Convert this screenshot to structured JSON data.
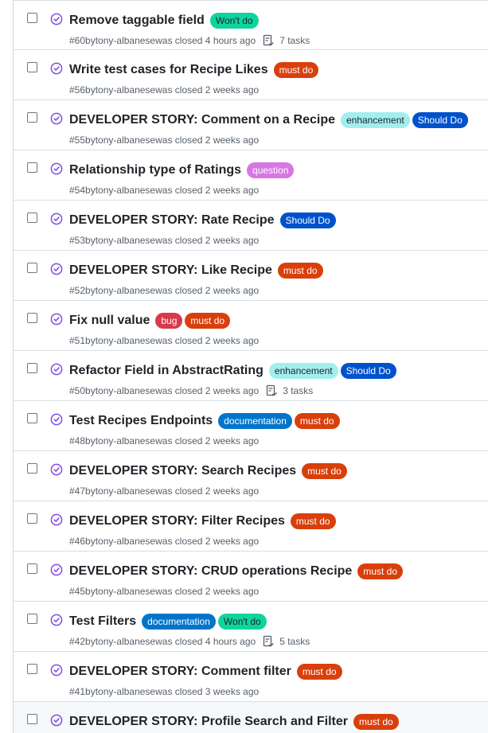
{
  "colors": {
    "closed_icon": "#8250df",
    "wont_do": "#0fd49e",
    "must_do": "#d93f0b",
    "enhancement": "#a2eeef",
    "should_do": "#0052cc",
    "question": "#d876e3",
    "bug": "#d73a4a",
    "documentation": "#0075ca"
  },
  "issues": [
    {
      "title": "Remove taggable field",
      "labels": [
        {
          "text": "Won't do",
          "kind": "wont_do"
        }
      ],
      "number": "#60",
      "by": "by",
      "author": "tony-albanese",
      "closed_text": "was closed 4 hours ago",
      "tasks": "7 tasks"
    },
    {
      "title": "Write test cases for Recipe Likes",
      "labels": [
        {
          "text": "must do",
          "kind": "must_do"
        }
      ],
      "number": "#56",
      "by": "by",
      "author": "tony-albanese",
      "closed_text": "was closed 2 weeks ago"
    },
    {
      "title": "DEVELOPER STORY: Comment on a Recipe",
      "labels": [
        {
          "text": "enhancement",
          "kind": "enhancement"
        },
        {
          "text": "Should Do",
          "kind": "should_do"
        }
      ],
      "number": "#55",
      "by": "by",
      "author": "tony-albanese",
      "closed_text": "was closed 2 weeks ago"
    },
    {
      "title": "Relationship type of Ratings",
      "labels": [
        {
          "text": "question",
          "kind": "question"
        }
      ],
      "number": "#54",
      "by": "by",
      "author": "tony-albanese",
      "closed_text": "was closed 2 weeks ago"
    },
    {
      "title": "DEVELOPER STORY: Rate Recipe",
      "labels": [
        {
          "text": "Should Do",
          "kind": "should_do"
        }
      ],
      "number": "#53",
      "by": "by",
      "author": "tony-albanese",
      "closed_text": "was closed 2 weeks ago"
    },
    {
      "title": "DEVELOPER STORY: Like Recipe",
      "labels": [
        {
          "text": "must do",
          "kind": "must_do"
        }
      ],
      "number": "#52",
      "by": "by",
      "author": "tony-albanese",
      "closed_text": "was closed 2 weeks ago"
    },
    {
      "title": "Fix null value",
      "labels": [
        {
          "text": "bug",
          "kind": "bug"
        },
        {
          "text": "must do",
          "kind": "must_do"
        }
      ],
      "number": "#51",
      "by": "by",
      "author": "tony-albanese",
      "closed_text": "was closed 2 weeks ago"
    },
    {
      "title": "Refactor Field in AbstractRating",
      "labels": [
        {
          "text": "enhancement",
          "kind": "enhancement"
        },
        {
          "text": "Should Do",
          "kind": "should_do"
        }
      ],
      "number": "#50",
      "by": "by",
      "author": "tony-albanese",
      "closed_text": "was closed 2 weeks ago",
      "tasks": "3 tasks"
    },
    {
      "title": "Test Recipes Endpoints",
      "labels": [
        {
          "text": "documentation",
          "kind": "documentation"
        },
        {
          "text": "must do",
          "kind": "must_do"
        }
      ],
      "number": "#48",
      "by": "by",
      "author": "tony-albanese",
      "closed_text": "was closed 2 weeks ago"
    },
    {
      "title": "DEVELOPER STORY: Search Recipes",
      "labels": [
        {
          "text": "must do",
          "kind": "must_do"
        }
      ],
      "number": "#47",
      "by": "by",
      "author": "tony-albanese",
      "closed_text": "was closed 2 weeks ago"
    },
    {
      "title": "DEVELOPER STORY: Filter Recipes",
      "labels": [
        {
          "text": "must do",
          "kind": "must_do"
        }
      ],
      "number": "#46",
      "by": "by",
      "author": "tony-albanese",
      "closed_text": "was closed 2 weeks ago"
    },
    {
      "title": "DEVELOPER STORY: CRUD operations Recipe",
      "labels": [
        {
          "text": "must do",
          "kind": "must_do"
        }
      ],
      "number": "#45",
      "by": "by",
      "author": "tony-albanese",
      "closed_text": "was closed 2 weeks ago"
    },
    {
      "title": "Test Filters",
      "labels": [
        {
          "text": "documentation",
          "kind": "documentation"
        },
        {
          "text": "Won't do",
          "kind": "wont_do"
        }
      ],
      "number": "#42",
      "by": "by",
      "author": "tony-albanese",
      "closed_text": "was closed 4 hours ago",
      "tasks": "5 tasks"
    },
    {
      "title": "DEVELOPER STORY: Comment filter",
      "labels": [
        {
          "text": "must do",
          "kind": "must_do"
        }
      ],
      "number": "#41",
      "by": "by",
      "author": "tony-albanese",
      "closed_text": "was closed 3 weeks ago"
    },
    {
      "title": "DEVELOPER STORY: Profile Search and Filter",
      "labels": [
        {
          "text": "must do",
          "kind": "must_do"
        }
      ],
      "number": "",
      "by": "",
      "author": "",
      "closed_text": "",
      "hover": true
    }
  ]
}
